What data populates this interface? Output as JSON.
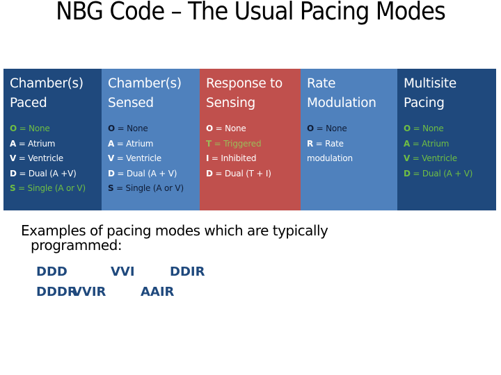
{
  "title": "NBG Code – The Usual Pacing Modes",
  "columns": [
    {
      "header": "Chamber(s) Paced",
      "items": [
        {
          "code": "O",
          "desc": " = None",
          "color": "green"
        },
        {
          "code": "A",
          "desc": " = Atrium",
          "color": "white"
        },
        {
          "code": "V",
          "desc": " = Ventricle",
          "color": "white"
        },
        {
          "code": "D",
          "desc": " = Dual (A +V)",
          "color": "white"
        },
        {
          "code": "S",
          "desc": " = Single (A or V)",
          "color": "green"
        }
      ]
    },
    {
      "header": "Chamber(s) Sensed",
      "items": [
        {
          "code": "O",
          "desc": " = None",
          "color": "dark"
        },
        {
          "code": "A",
          "desc": " = Atrium",
          "color": "white"
        },
        {
          "code": "V",
          "desc": " = Ventricle",
          "color": "white"
        },
        {
          "code": "D",
          "desc": " = Dual (A + V)",
          "color": "white"
        },
        {
          "code": "S",
          "desc": " = Single (A or V)",
          "color": "dark"
        }
      ]
    },
    {
      "header": "Response to Sensing",
      "items": [
        {
          "code": "O",
          "desc": " = None",
          "color": "white"
        },
        {
          "code": "T",
          "desc": " = Triggered",
          "color": "olive"
        },
        {
          "code": "I",
          "desc": " = Inhibited",
          "color": "white"
        },
        {
          "code": "D",
          "desc": " = Dual (T + I)",
          "color": "white"
        }
      ]
    },
    {
      "header": "Rate Modulation",
      "items": [
        {
          "code": "O",
          "desc": " = None",
          "color": "dark"
        },
        {
          "code": "R",
          "desc": " = Rate modulation",
          "color": "white"
        }
      ]
    },
    {
      "header": "Multisite Pacing",
      "items": [
        {
          "code": "O",
          "desc": " = None",
          "color": "green"
        },
        {
          "code": "A",
          "desc": " = Atrium",
          "color": "green"
        },
        {
          "code": "V",
          "desc": " = Ventricle",
          "color": "green"
        },
        {
          "code": "D",
          "desc": " = Dual (A + V)",
          "color": "green"
        }
      ]
    }
  ],
  "examples": {
    "intro_line1": "Examples of pacing modes which are typically",
    "intro_line2": "programmed:",
    "modes": [
      "DDD",
      "VVI",
      "DDIR",
      "DDDR",
      "VVIR",
      "AAIR"
    ]
  },
  "colors": {
    "dark_blue": "#1f497d",
    "mid_blue": "#4f81bd",
    "red": "#c0504d",
    "green": "#6fbe44",
    "olive": "#9bbb59"
  }
}
